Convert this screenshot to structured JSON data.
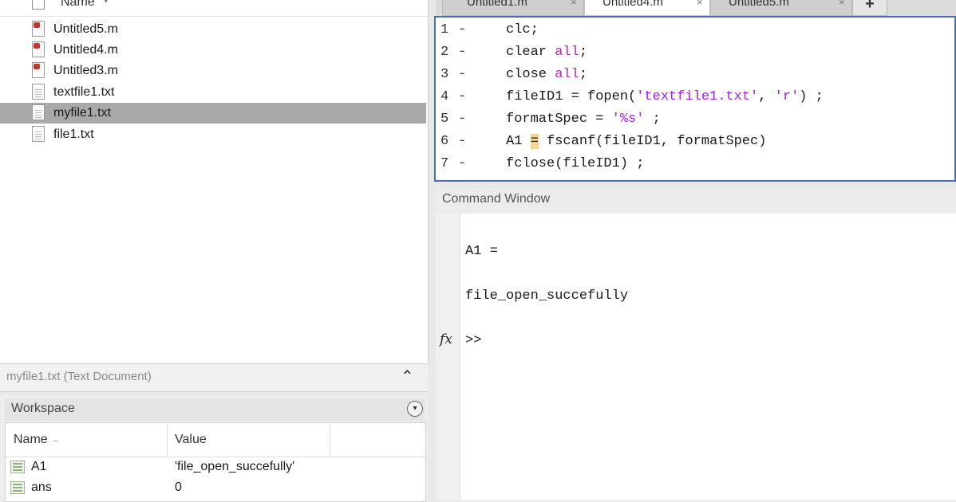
{
  "folder": {
    "column_name": "Name",
    "files": [
      {
        "name": "Untitled5.m",
        "type": "m",
        "selected": false
      },
      {
        "name": "Untitled4.m",
        "type": "m",
        "selected": false
      },
      {
        "name": "Untitled3.m",
        "type": "m",
        "selected": false
      },
      {
        "name": "textfile1.txt",
        "type": "txt",
        "selected": false
      },
      {
        "name": "myfile1.txt",
        "type": "txt",
        "selected": true
      },
      {
        "name": "file1.txt",
        "type": "txt",
        "selected": false
      }
    ],
    "details": "myfile1.txt (Text Document)",
    "details_chevron": "^"
  },
  "workspace": {
    "title": "Workspace",
    "menu_icon": "▾",
    "columns": {
      "name": "Name",
      "sort_indicator": "▲",
      "value": "Value"
    },
    "vars": [
      {
        "name": "A1",
        "value": "'file_open_succefully'"
      },
      {
        "name": "ans",
        "value": "0"
      }
    ]
  },
  "editor": {
    "tabs": [
      {
        "label": "Untitled1.m",
        "close": "×",
        "active": false
      },
      {
        "label": "Untitled4.m",
        "close": "×",
        "active": true
      },
      {
        "label": "Untitled5.m",
        "close": "×",
        "active": false
      }
    ],
    "add_tab": "+",
    "lines": [
      {
        "num": "1",
        "marker": "-",
        "code": "clc;"
      },
      {
        "num": "2",
        "marker": "-",
        "code": "clear all;"
      },
      {
        "num": "3",
        "marker": "-",
        "code": "close all;"
      },
      {
        "num": "4",
        "marker": "-",
        "code": "fileID1 = fopen('textfile1.txt', 'r') ;"
      },
      {
        "num": "5",
        "marker": "-",
        "code": "formatSpec = '%s' ;"
      },
      {
        "num": "6",
        "marker": "-",
        "code": "A1 = fscanf(fileID1, formatSpec)"
      },
      {
        "num": "7",
        "marker": "-",
        "code": "fclose(fileID1) ;"
      }
    ]
  },
  "command_window": {
    "title": "Command Window",
    "output_var": "A1 =",
    "output_value": "file_open_succefully",
    "fx": "fx",
    "prompt": ">>"
  },
  "colors": {
    "selection": "#a9a9a9",
    "editor_border": "#4a6fa5",
    "string_purple": "#a020f0"
  }
}
